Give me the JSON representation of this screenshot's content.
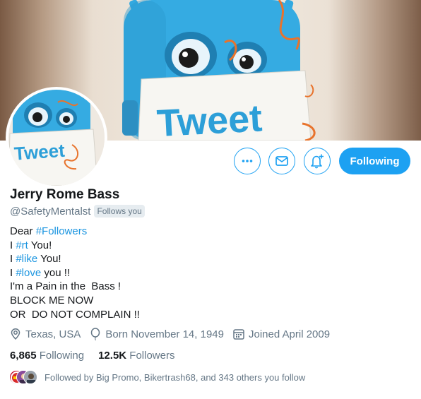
{
  "profile": {
    "name": "Jerry Rome Bass",
    "handle": "@SafetyMentalst",
    "follows_you": "Follows you"
  },
  "banner": {
    "sign_text": "Tweet"
  },
  "avatar": {
    "sign_text": "Tweet"
  },
  "actions": {
    "more_icon": "more-icon",
    "message_icon": "envelope-icon",
    "notify_icon": "bell-plus-icon",
    "following_label": "Following"
  },
  "bio": {
    "l1_text": "Dear ",
    "l1_tag": "#Followers",
    "l2_text": "I ",
    "l2_tag": "#rt",
    "l2_rest": " You!",
    "l3_text": "I ",
    "l3_tag": "#like",
    "l3_rest": " You!",
    "l4_text": "I ",
    "l4_tag": "#love",
    "l4_rest": " you !!",
    "l5": "I'm a Pain in the  Bass !",
    "l6": "BLOCK ME NOW",
    "l7": "OR  DO NOT COMPLAIN !!"
  },
  "meta": {
    "location": "Texas, USA",
    "birthday": "Born November 14, 1949",
    "joined": "Joined April 2009"
  },
  "stats": {
    "following_count": "6,865",
    "following_label": "Following",
    "followers_count": "12.5K",
    "followers_label": "Followers"
  },
  "followed_by": "Followed by Big Promo, Bikertrash68, and 343 others you follow",
  "colors": {
    "accent": "#1da1f2",
    "hashtag": "#1b95e0",
    "muted": "#657786",
    "robot": "#33a9e0"
  }
}
